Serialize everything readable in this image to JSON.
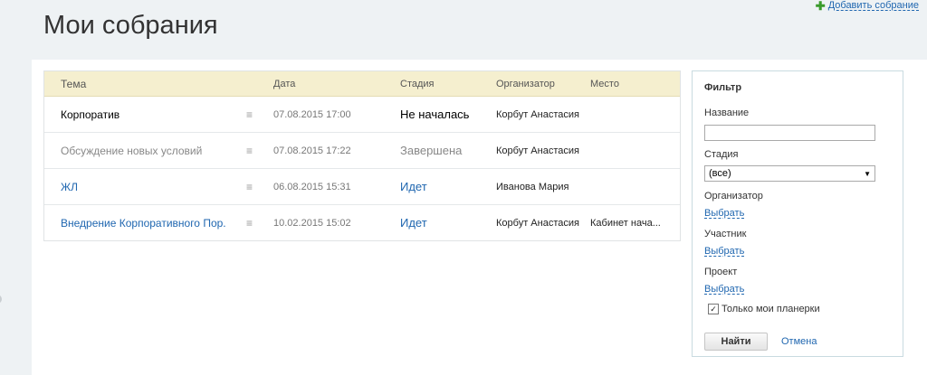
{
  "header": {
    "add_link": "Добавить собрание",
    "title": "Мои собрания"
  },
  "grid": {
    "columns": {
      "topic": "Тема",
      "date": "Дата",
      "stage": "Стадия",
      "organizer": "Организатор",
      "place": "Место"
    },
    "rows": [
      {
        "topic": "Корпоратив",
        "date": "07.08.2015 17:00",
        "stage": "Не началась",
        "organizer": "Корбут Анастасия",
        "place": ""
      },
      {
        "topic": "Обсуждение новых условий",
        "date": "07.08.2015 17:22",
        "stage": "Завершена",
        "organizer": "Корбут Анастасия",
        "place": ""
      },
      {
        "topic": "ЖЛ",
        "date": "06.08.2015 15:31",
        "stage": "Идет",
        "organizer": "Иванова Мария",
        "place": ""
      },
      {
        "topic": "Внедрение Корпоративного Пор...",
        "date": "10.02.2015 15:02",
        "stage": "Идет",
        "organizer": "Корбут Анастасия",
        "place": "Кабинет нача..."
      }
    ]
  },
  "filter": {
    "title": "Фильтр",
    "name_label": "Название",
    "name_value": "",
    "stage_label": "Стадия",
    "stage_value": "(все)",
    "organizer_label": "Организатор",
    "organizer_link": "Выбрать",
    "participant_label": "Участник",
    "participant_link": "Выбрать",
    "project_label": "Проект",
    "project_link": "Выбрать",
    "only_mine_label": "Только мои планерки",
    "only_mine_checked": true,
    "find_button": "Найти",
    "cancel_link": "Отмена"
  },
  "icons": {
    "add": "plus-icon",
    "row_menu": "menu-icon",
    "select_arrow": "chevron-down-icon"
  },
  "colors": {
    "link": "#2067b0",
    "grid_header": "#f5efcf",
    "add_plus": "#3a9b2b"
  }
}
